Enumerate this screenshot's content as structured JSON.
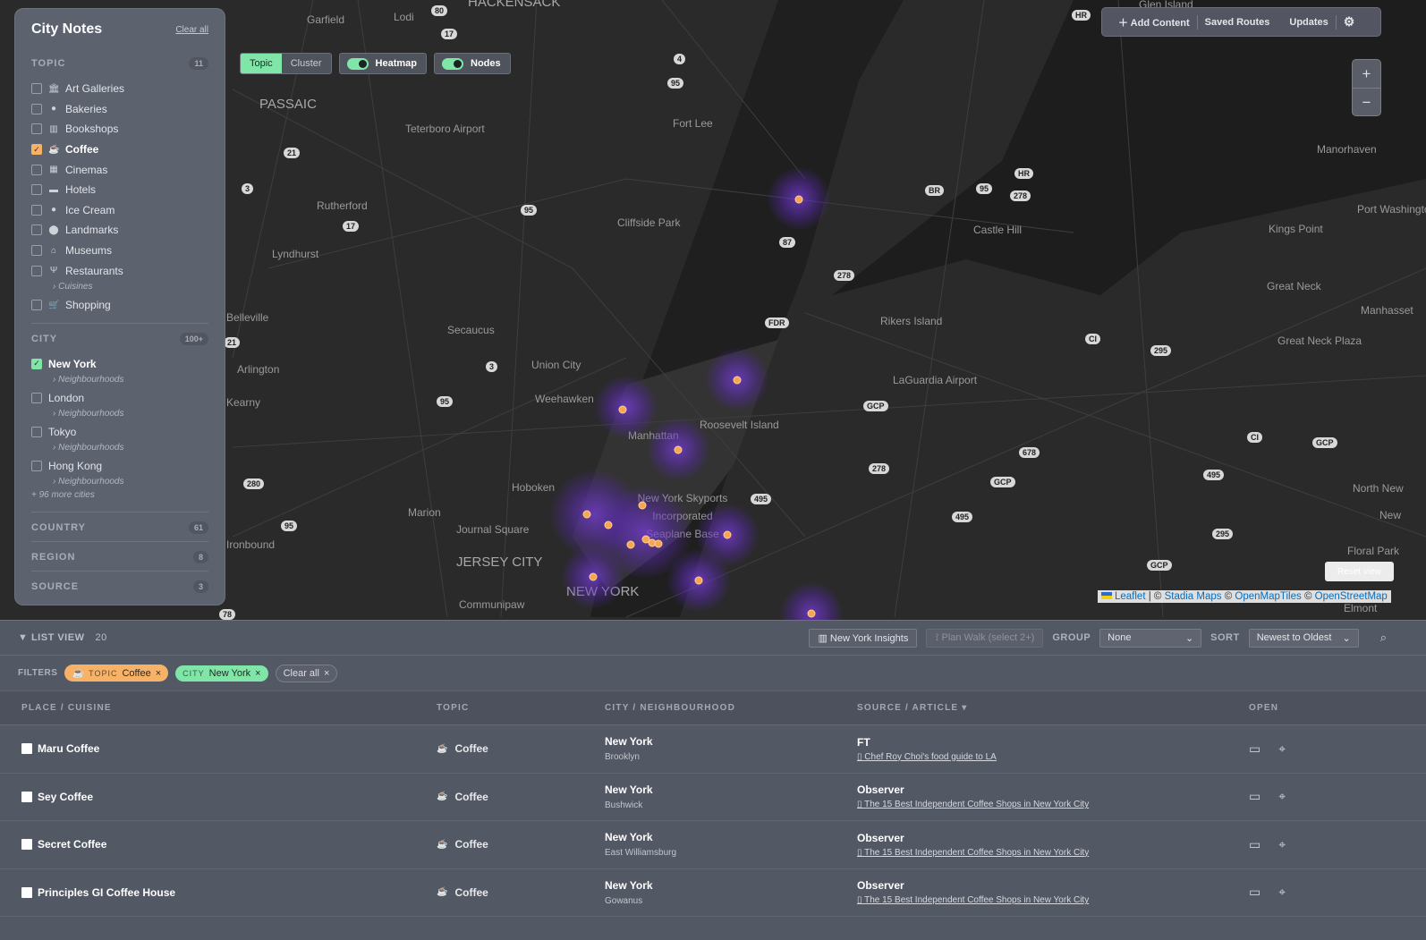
{
  "map": {
    "labels": [
      "Garfield",
      "Lodi",
      "HACKENSACK",
      "PASSAIC",
      "Teterboro Airport",
      "Fort Lee",
      "Rutherford",
      "Cliffside Park",
      "Lyndhurst",
      "Secaucus",
      "Union City",
      "Arlington",
      "Weehawken",
      "Kearny",
      "Manhattan",
      "Roosevelt Island",
      "Rikers Island",
      "LaGuardia Airport",
      "Castle Hill",
      "Manorhaven",
      "Kings Point",
      "Great Neck",
      "Great Neck Plaza",
      "Port Washington",
      "Manhasset",
      "Hoboken",
      "Marion",
      "Journal Square",
      "JERSEY CITY",
      "New York Skyports Incorporated Seaplane Base",
      "NEW YORK",
      "Communipaw",
      "Ironbound",
      "North New",
      "New",
      "Floral Park",
      "Elmont",
      "Glen Island",
      "Belleville"
    ],
    "shields": [
      "80",
      "17",
      "4",
      "95",
      "21",
      "3",
      "17",
      "95",
      "87",
      "278",
      "BR",
      "95",
      "278",
      "HR",
      "FDR",
      "CI",
      "295",
      "3",
      "95",
      "21",
      "GCP",
      "278",
      "678",
      "GCP",
      "495",
      "495",
      "CI",
      "GCP",
      "495",
      "295",
      "GCP",
      "280",
      "95",
      "78",
      "HR"
    ],
    "attribution": {
      "leaflet": "Leaflet",
      "stadia": "Stadia Maps",
      "omt": "OpenMapTiles",
      "osm": "OpenStreetMap"
    },
    "reset_view": "Reset view"
  },
  "modes": {
    "topic": "Topic",
    "cluster": "Cluster",
    "heatmap": "Heatmap",
    "nodes": "Nodes"
  },
  "topbar": {
    "add_content": "Add Content",
    "saved_routes": "Saved Routes",
    "updates": "Updates"
  },
  "zoom": {
    "in": "+",
    "out": "−"
  },
  "sidebar": {
    "title": "City Notes",
    "clear_all": "Clear all",
    "topic": {
      "label": "TOPIC",
      "count": "11",
      "items": [
        {
          "label": "Art Galleries",
          "icon": "🏛"
        },
        {
          "label": "Bakeries",
          "icon": "●"
        },
        {
          "label": "Bookshops",
          "icon": "▥"
        },
        {
          "label": "Coffee",
          "icon": "☕"
        },
        {
          "label": "Cinemas",
          "icon": "▦"
        },
        {
          "label": "Hotels",
          "icon": "▬"
        },
        {
          "label": "Ice Cream",
          "icon": "●"
        },
        {
          "label": "Landmarks",
          "icon": "⬤"
        },
        {
          "label": "Museums",
          "icon": "⌂"
        },
        {
          "label": "Restaurants",
          "icon": "Ψ"
        },
        {
          "label": "Shopping",
          "icon": "🛒"
        }
      ],
      "cuisines": "› Cuisines"
    },
    "city": {
      "label": "CITY",
      "count": "100+",
      "items": [
        "New York",
        "London",
        "Tokyo",
        "Hong Kong"
      ],
      "sub": "› Neighbourhoods",
      "more": "+ 96 more cities"
    },
    "country": {
      "label": "COUNTRY",
      "count": "61"
    },
    "region": {
      "label": "REGION",
      "count": "8"
    },
    "source": {
      "label": "SOURCE",
      "count": "3"
    }
  },
  "list": {
    "title": "LIST VIEW",
    "count": "20",
    "insights": "New York Insights",
    "plan_walk": "Plan Walk (select 2+)",
    "group_label": "GROUP",
    "group_value": "None",
    "sort_label": "SORT",
    "sort_value": "Newest to Oldest",
    "filters_label": "FILTERS",
    "filters": [
      {
        "key": "TOPIC",
        "value": "Coffee"
      },
      {
        "key": "CITY",
        "value": "New York"
      }
    ],
    "clear_all": "Clear all",
    "columns": [
      "PLACE / CUISINE",
      "TOPIC",
      "CITY / NEIGHBOURHOOD",
      "SOURCE / ARTICLE ▾",
      "OPEN"
    ],
    "rows": [
      {
        "name": "Maru Coffee",
        "topic": "Coffee",
        "city": "New York",
        "hood": "Brooklyn",
        "source": "FT",
        "article": "Chef Roy Choi's food guide to LA"
      },
      {
        "name": "Sey Coffee",
        "topic": "Coffee",
        "city": "New York",
        "hood": "Bushwick",
        "source": "Observer",
        "article": "The 15 Best Independent Coffee Shops in New York City"
      },
      {
        "name": "Secret Coffee",
        "topic": "Coffee",
        "city": "New York",
        "hood": "East Williamsburg",
        "source": "Observer",
        "article": "The 15 Best Independent Coffee Shops in New York City"
      },
      {
        "name": "Principles GI Coffee House",
        "topic": "Coffee",
        "city": "New York",
        "hood": "Gowanus",
        "source": "Observer",
        "article": "The 15 Best Independent Coffee Shops in New York City"
      }
    ]
  },
  "colors": {
    "accent_green": "#7fe6a8",
    "accent_orange": "#f7b267",
    "heat_point": "#f7a64f"
  }
}
